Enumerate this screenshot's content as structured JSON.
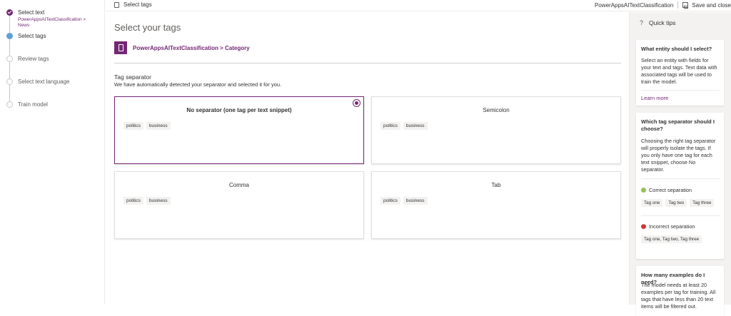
{
  "stepper": {
    "steps": [
      {
        "label": "Select text",
        "sub": "PowerAppsAITextClassification > News",
        "state": "done"
      },
      {
        "label": "Select tags",
        "state": "current"
      },
      {
        "label": "Review tags",
        "state": "todo"
      },
      {
        "label": "Select text language",
        "state": "todo"
      },
      {
        "label": "Train model",
        "state": "todo"
      }
    ]
  },
  "topbar": {
    "breadcrumb": "Select tags",
    "entity_name": "PowerAppsAITextClassification",
    "save_label": "Save and close"
  },
  "main": {
    "title": "Select your tags",
    "entity_path": "PowerAppsAITextClassification > Category",
    "section_title": "Tag separator",
    "section_desc": "We have automatically detected your separator and selected it for you.",
    "cards": [
      {
        "title": "No separator (one tag per text snippet)",
        "tags": [
          "politics",
          "business"
        ],
        "selected": true
      },
      {
        "title": "Semicolon",
        "tags": [
          "politics",
          "business"
        ],
        "selected": false
      },
      {
        "title": "Comma",
        "tags": [
          "politics",
          "business"
        ],
        "selected": false
      },
      {
        "title": "Tab",
        "tags": [
          "politics",
          "business"
        ],
        "selected": false
      }
    ]
  },
  "tips": {
    "heading": "Quick tips",
    "card1": {
      "title": "What entity should I select?",
      "body": "Select an entity with fields for your text and tags. Text data with associated tags will be used to train the model.",
      "link": "Learn more"
    },
    "card2": {
      "title": "Which tag separator should I choose?",
      "body": "Choosing the right tag separator will properly isolate the tags. If you only have one tag for each text snippet, choose No separator.",
      "correct_label": "Correct separation",
      "correct_tags": [
        "Tag one",
        "Tag two",
        "Tag three"
      ],
      "incorrect_label": "Incorrect separation",
      "incorrect_tags": [
        "Tag one, Tag two, Tag three"
      ]
    },
    "card3": {
      "title": "How many examples do I need?",
      "body": "The model needs at least 20 examples per tag for training. All tags that have less than 20 text items will be filtered out."
    }
  }
}
